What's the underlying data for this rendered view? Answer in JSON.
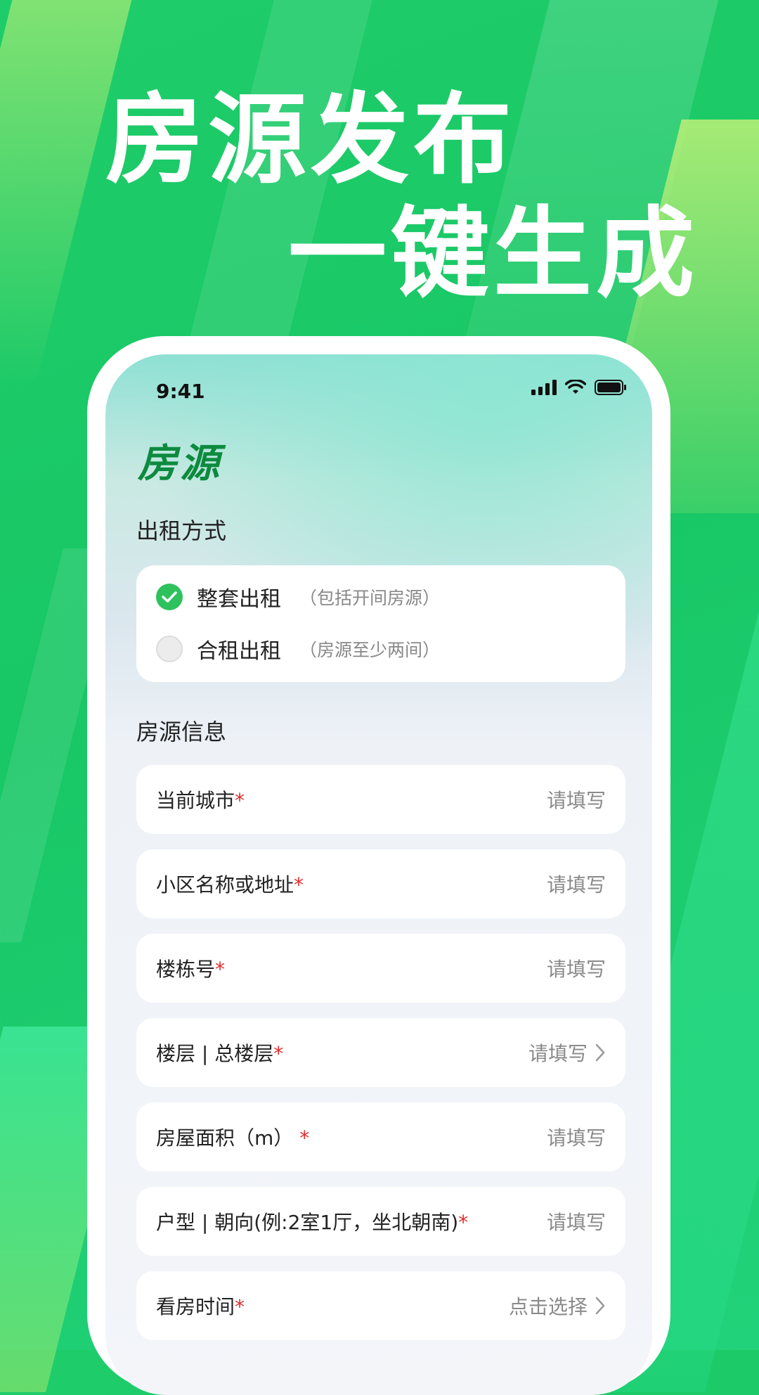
{
  "hero": {
    "line1": "房源发布",
    "line2": "一键生成"
  },
  "status_bar": {
    "time": "9:41",
    "icons": [
      "signal-icon",
      "wifi-icon",
      "battery-icon"
    ]
  },
  "page": {
    "title": "房源"
  },
  "rent_mode": {
    "label": "出租方式",
    "options": [
      {
        "label": "整套出租",
        "note": "（包括开间房源）",
        "selected": true
      },
      {
        "label": "合租出租",
        "note": "（房源至少两间）",
        "selected": false
      }
    ]
  },
  "listing_info": {
    "label": "房源信息",
    "required_mark": "*",
    "fields": [
      {
        "label": "当前城市",
        "placeholder": "请填写",
        "chevron": false
      },
      {
        "label": "小区名称或地址",
        "placeholder": "请填写",
        "chevron": false
      },
      {
        "label": "楼栋号",
        "placeholder": "请填写",
        "chevron": false
      },
      {
        "label": "楼层 | 总楼层",
        "placeholder": "请填写",
        "chevron": true
      },
      {
        "label": "房屋面积（m）",
        "placeholder": "请填写",
        "chevron": false
      },
      {
        "label": "户型 | 朝向(例:2室1厅，坐北朝南)",
        "placeholder": "请填写",
        "chevron": false
      },
      {
        "label": "看房时间",
        "placeholder": "点击选择",
        "chevron": true
      }
    ]
  },
  "colors": {
    "brand_green": "#1fcc6a",
    "check_green": "#2fc15d",
    "title_green": "#0d8a3e",
    "required_red": "#e02c2c"
  }
}
